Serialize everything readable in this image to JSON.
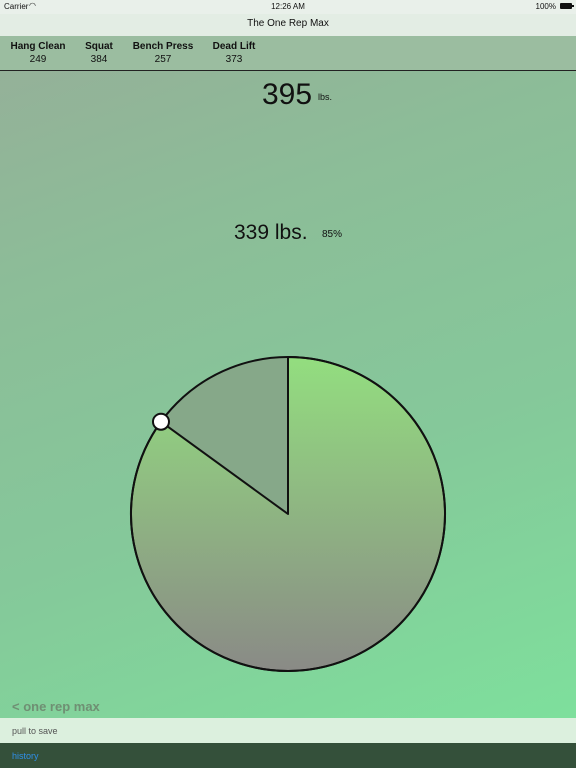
{
  "status_bar": {
    "carrier": "Carrier",
    "time": "12:26 AM",
    "battery": "100%"
  },
  "nav": {
    "title": "The One Rep Max"
  },
  "lifts": [
    {
      "name": "Hang Clean",
      "value": "249"
    },
    {
      "name": "Squat",
      "value": "384"
    },
    {
      "name": "Bench Press",
      "value": "257"
    },
    {
      "name": "Dead Lift",
      "value": "373"
    }
  ],
  "max": {
    "value": "395",
    "unit": "lbs."
  },
  "working": {
    "value": "339 lbs.",
    "percent": "85%",
    "fraction": 0.85
  },
  "colors": {
    "pie_fill_top": "#93de7f",
    "pie_fill_bottom": "#8a8a86",
    "pie_remainder": "#86a889",
    "outline": "#111111"
  },
  "footer": {
    "back_label": "< one rep max",
    "pull_label": "pull to save",
    "history_label": "history"
  }
}
